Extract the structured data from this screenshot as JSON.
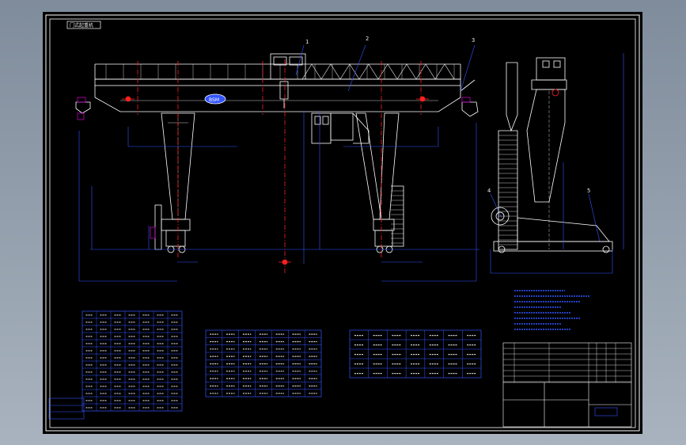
{
  "drawing": {
    "title_tag": "门式起重机",
    "balloons": [
      "1",
      "2",
      "3",
      "4",
      "5"
    ],
    "logo_text": "BSM"
  },
  "colors": {
    "background": "#000000",
    "structure": "#ffffff",
    "dimension": "#3355ff",
    "center_mark": "#ff2020",
    "hatch": "#c000c0",
    "border": "#ffffff",
    "table_lines": "#3355ff"
  },
  "tables": {
    "params_rows": 14,
    "params_cols": 7,
    "speed_rows": 9,
    "speed_cols": 7,
    "wheel_rows": 5,
    "wheel_cols": 7
  },
  "notes_lines": 8
}
